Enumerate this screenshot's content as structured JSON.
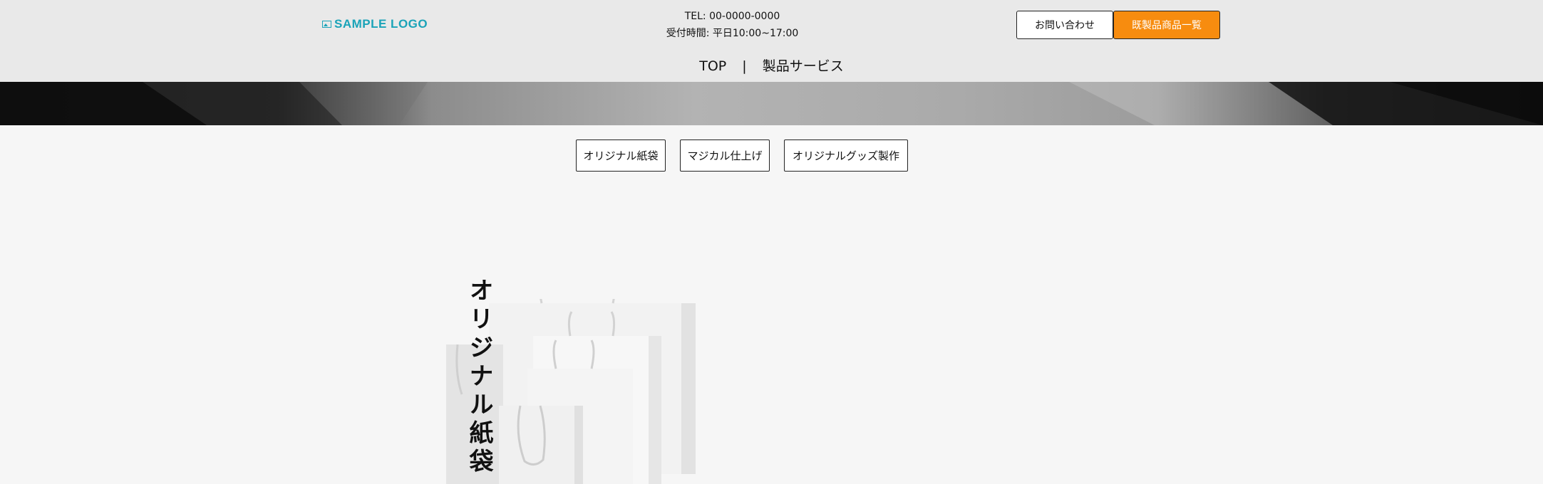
{
  "header": {
    "logo_text": "SAMPLE LOGO",
    "tel": "TEL: 00-0000-0000",
    "hours": "受付時間: 平日10:00~17:00",
    "contact_button": "お問い合わせ",
    "catalog_button": "既製品商品一覧"
  },
  "nav": {
    "items": [
      "TOP",
      "製品サービス"
    ],
    "separator": "|"
  },
  "tabs": [
    "オリジナル紙袋",
    "マジカル仕上げ",
    "オリジナルグッズ製作"
  ],
  "section": {
    "title": "オリジナル紙袋"
  },
  "colors": {
    "accent": "#f78c0f",
    "logo": "#1aa3b8",
    "header_bg": "#e9e9e9",
    "page_bg": "#f6f6f6"
  }
}
